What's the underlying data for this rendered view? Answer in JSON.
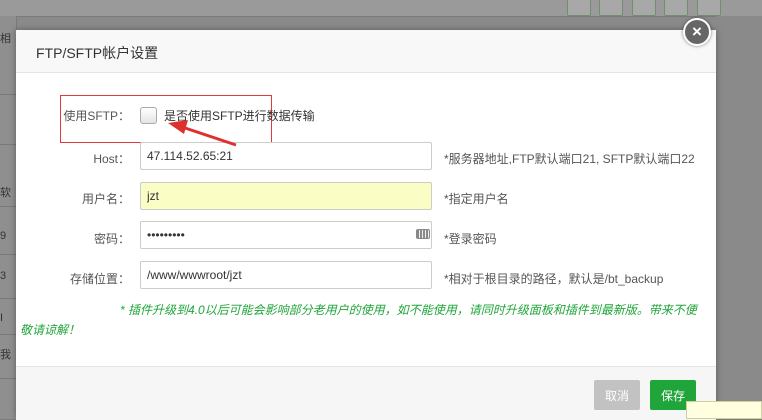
{
  "dialog": {
    "title": "FTP/SFTP帐户设置"
  },
  "sftp": {
    "label": "使用SFTP：",
    "description": "是否使用SFTP进行数据传输",
    "checked": false
  },
  "host": {
    "label": "Host：",
    "value": "47.114.52.65:21",
    "hint": "*服务器地址,FTP默认端口21, SFTP默认端口22"
  },
  "username": {
    "label": "用户名：",
    "value": "jzt",
    "hint": "*指定用户名"
  },
  "password": {
    "label": "密码：",
    "value": "•••••••••",
    "hint": "*登录密码"
  },
  "storage": {
    "label": "存储位置：",
    "value": "/www/wwwroot/jzt",
    "hint": "*相对于根目录的路径，默认是/bt_backup"
  },
  "notice": {
    "line1": "* 插件升级到4.0以后可能会影响部分老用户的使用，如不能使用，请同时升级面板和插件到最新版。带来不便",
    "line2": "敬请谅解！"
  },
  "buttons": {
    "cancel": "取消",
    "save": "保存"
  },
  "background": {
    "left_fragments": [
      "相",
      "软",
      "9",
      "3",
      "I",
      "我"
    ]
  },
  "colors": {
    "accent": "#20a53a",
    "highlight_box": "#e03a3a",
    "autofill": "#fafdc4"
  }
}
